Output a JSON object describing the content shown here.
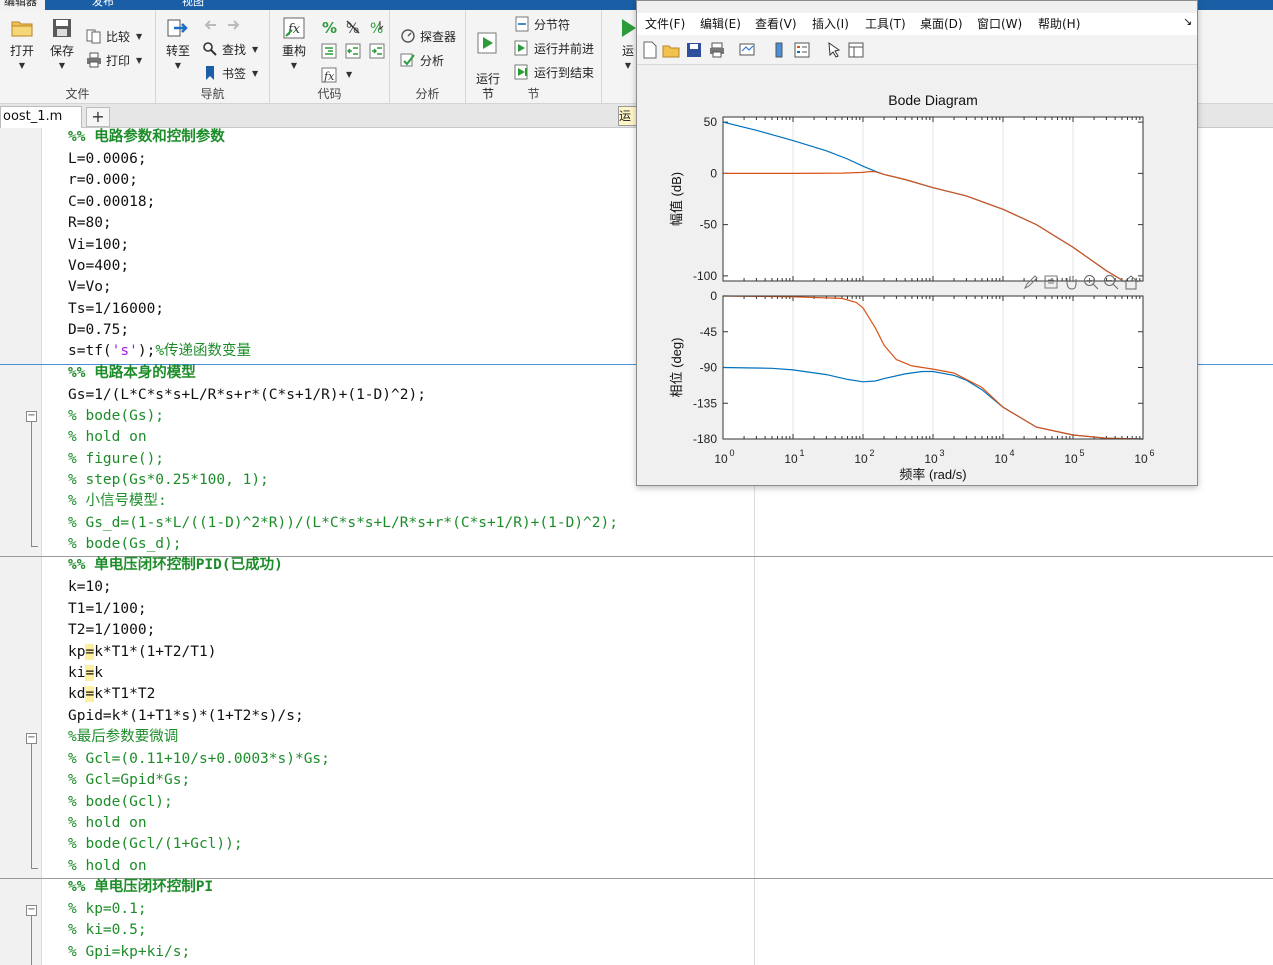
{
  "ribbon": {
    "tabs": {
      "home": "编辑器",
      "publish": "发布",
      "view": "视图"
    },
    "file": {
      "open": "打开",
      "save": "保存",
      "compare": "比较",
      "print": "打印",
      "label": "文件"
    },
    "nav": {
      "goto": "转至",
      "find": "查找",
      "bookmark": "书签",
      "label": "导航"
    },
    "code": {
      "refactor": "重构",
      "label": "代码"
    },
    "analyze": {
      "profiler": "探查器",
      "analyze": "分析",
      "label": "分析"
    },
    "section": {
      "run_section": "运行\n节",
      "section_break": "分节符",
      "run_advance": "运行并前进",
      "run_to_end": "运行到结束",
      "label": "节"
    },
    "run": {
      "label": "运"
    }
  },
  "editor": {
    "file_tab": "oost_1.m",
    "add_tab": "+",
    "run_hint": "运",
    "lines": [
      "%% 电路参数和控制参数",
      "L=0.0006;",
      "r=0.000;",
      "C=0.00018;",
      "R=80;",
      "Vi=100;",
      "Vo=400;",
      "V=Vo;",
      "Ts=1/16000;",
      "D=0.75;",
      "s=tf(",
      "%% 电路本身的模型",
      "Gs=1/(L*C*s*s+L/R*s+r*(C*s+1/R)+(1-D)^2);",
      "% bode(Gs);",
      "% hold on",
      "% figure();",
      "% step(Gs*0.25*100, 1);",
      "% 小信号模型:",
      "% Gs_d=(1-s*L/((1-D)^2*R))/(L*C*s*s+L/R*s+r*(C*s+1/R)+(1-D)^2);",
      "% bode(Gs_d);",
      "%% 单电压闭环控制PID(已成功)",
      "k=10;",
      "T1=1/100;",
      "T2=1/1000;",
      "kp",
      "ki",
      "kd",
      "Gpid=k*(1+T1*s)*(1+T2*s)/s;",
      "%最后参数要微调",
      "% Gcl=(0.11+10/s+0.0003*s)*Gs;",
      "% Gcl=Gpid*Gs;",
      "% bode(Gcl);",
      "% hold on",
      "% bode(Gcl/(1+Gcl));",
      "% hold on",
      "%% 单电压闭环控制PI",
      "% kp=0.1;",
      "% ki=0.5;",
      "% Gpi=kp+ki/s;"
    ],
    "tf_str": "'s'",
    "tf_tail": ");",
    "tf_comment": "%传递函数变量",
    "kp_eq": "=",
    "kp_rest": "k*T1*(1+T2/T1)",
    "ki_eq": "=",
    "ki_rest": "k",
    "kd_eq": "=",
    "kd_rest": "k*T1*T2"
  },
  "figure": {
    "menus": [
      "文件(F)",
      "编辑(E)",
      "查看(V)",
      "插入(I)",
      "工具(T)",
      "桌面(D)",
      "窗口(W)",
      "帮助(H)"
    ],
    "dock_arrow": "↘"
  },
  "chart_data": {
    "type": "line",
    "title": "Bode Diagram",
    "xlabel": "频率  (rad/s)",
    "xscale": "log",
    "xlim": [
      1,
      1000000
    ],
    "x_ticks": [
      "10",
      "10",
      "10",
      "10",
      "10",
      "10",
      "10"
    ],
    "x_tick_exps": [
      "0",
      "1",
      "2",
      "3",
      "4",
      "5",
      "6"
    ],
    "magnitude": {
      "ylabel": "幅值 (dB)",
      "ylim": [
        -105,
        55
      ],
      "yticks": [
        "50",
        "0",
        "-50",
        "-100"
      ],
      "yticks_values": [
        50,
        0,
        -50,
        -100
      ],
      "series": [
        {
          "color": "#0072bd",
          "x": [
            1,
            3,
            10,
            30,
            60,
            100,
            150,
            200,
            400,
            1000,
            3000,
            10000,
            30000,
            100000,
            300000,
            500000
          ],
          "y": [
            50,
            42,
            32,
            22,
            14,
            7,
            2,
            -1,
            -6,
            -14,
            -22,
            -35,
            -50,
            -72,
            -95,
            -104
          ]
        },
        {
          "color": "#d95319",
          "x": [
            1,
            10,
            50,
            100,
            130,
            150,
            200,
            400,
            1000,
            3000,
            10000,
            30000,
            100000,
            300000,
            500000
          ],
          "y": [
            0,
            0,
            0.3,
            1,
            1.8,
            1.5,
            -1,
            -6,
            -14,
            -22,
            -35,
            -50,
            -72,
            -95,
            -104
          ]
        }
      ]
    },
    "phase": {
      "ylabel": "相位 (deg)",
      "ylim": [
        -180,
        0
      ],
      "yticks": [
        "0",
        "-45",
        "-90",
        "-135",
        "-180"
      ],
      "yticks_values": [
        0,
        -45,
        -90,
        -135,
        -180
      ],
      "series": [
        {
          "color": "#0072bd",
          "x": [
            1,
            5,
            10,
            30,
            60,
            100,
            150,
            200,
            400,
            700,
            1000,
            2000,
            3000,
            5000,
            10000,
            30000,
            100000,
            300000,
            1000000
          ],
          "y": [
            -90,
            -91,
            -93,
            -99,
            -105,
            -108,
            -107,
            -104,
            -98,
            -95,
            -95,
            -100,
            -106,
            -118,
            -140,
            -165,
            -175,
            -179,
            -180
          ]
        },
        {
          "color": "#d95319",
          "x": [
            1,
            10,
            50,
            80,
            100,
            150,
            200,
            300,
            500,
            1000,
            2000,
            5000,
            10000,
            30000,
            100000,
            300000,
            1000000
          ],
          "y": [
            0,
            -1,
            -3,
            -8,
            -15,
            -40,
            -62,
            -80,
            -88,
            -92,
            -97,
            -115,
            -140,
            -165,
            -175,
            -179,
            -180
          ]
        }
      ]
    }
  }
}
